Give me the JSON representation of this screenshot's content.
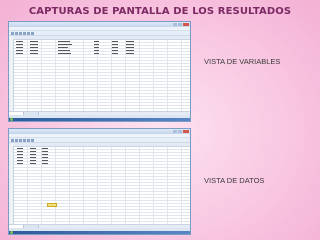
{
  "page": {
    "title": "CAPTURAS DE PANTALLA DE LOS RESULTADOS",
    "captions": {
      "variables": "VISTA DE VARIABLES",
      "data": "VISTA DE DATOS"
    }
  },
  "colors": {
    "title": "#7b2a63",
    "background": "#f9c8e2",
    "window_frame": "#7a9cc6",
    "selected_cell": "#f3e27c"
  }
}
